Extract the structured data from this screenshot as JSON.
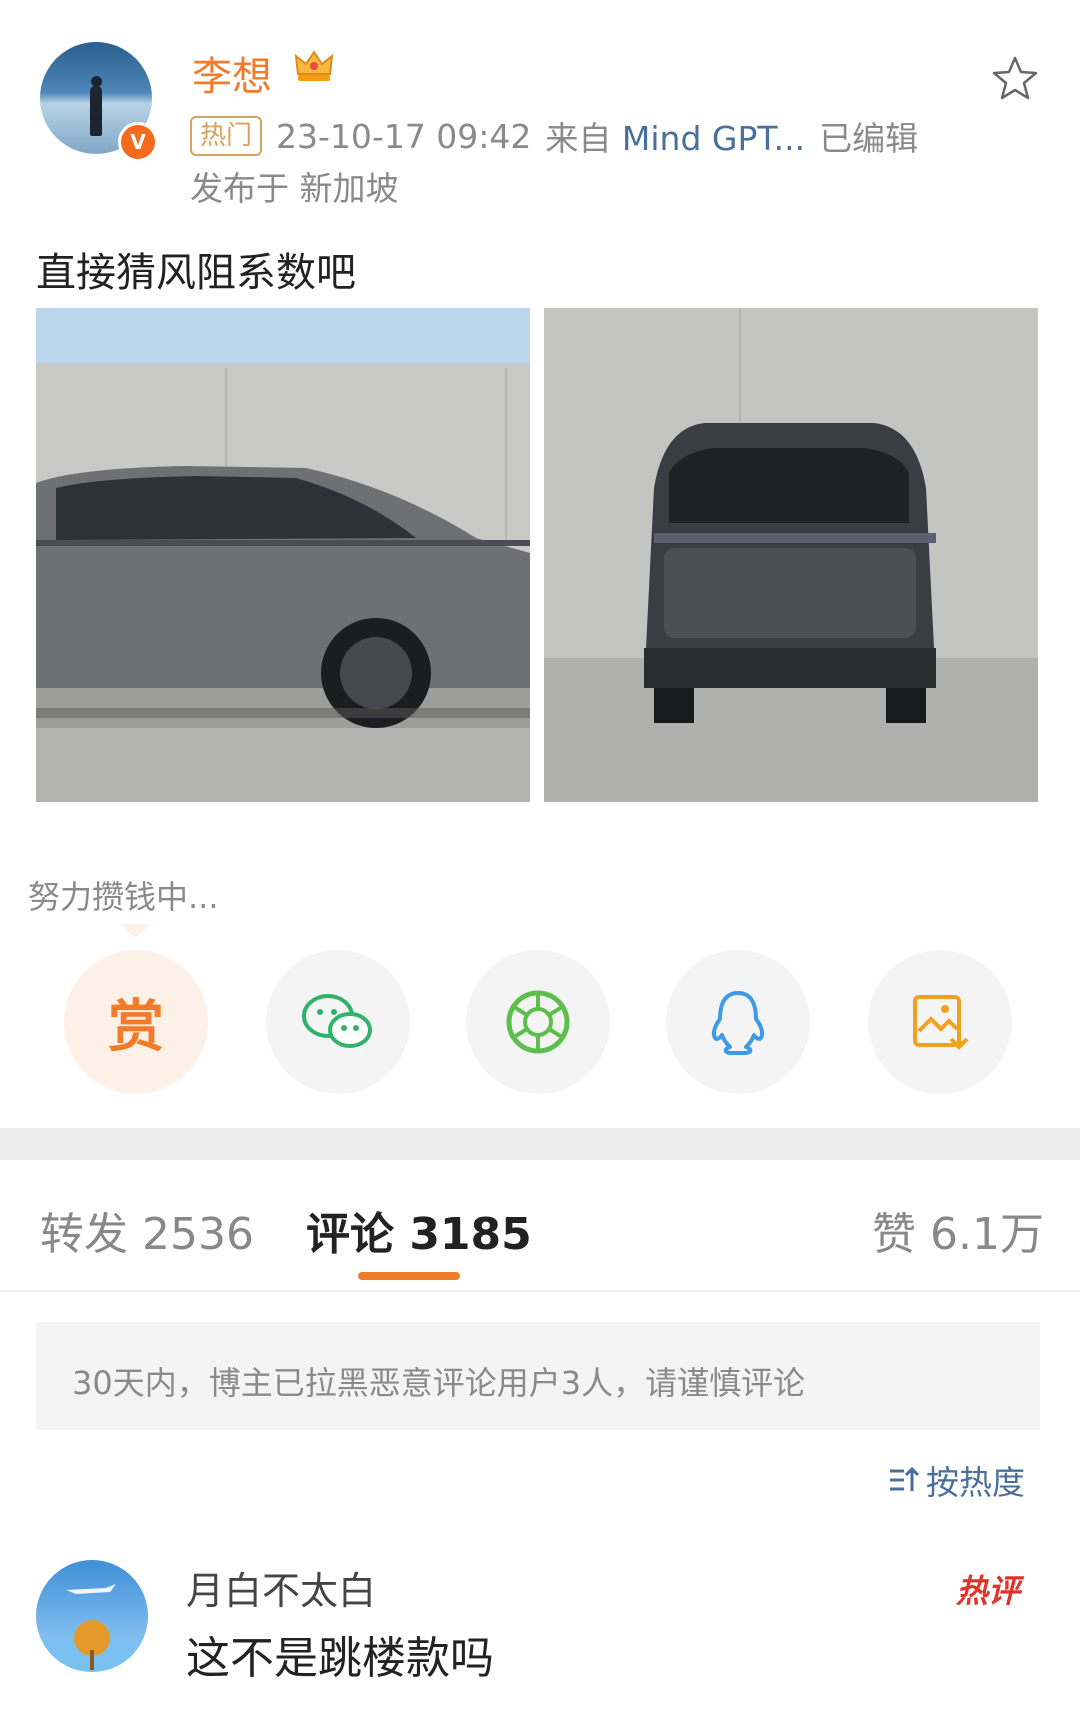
{
  "post": {
    "username": "李想",
    "hot_tag": "热门",
    "timestamp": "23-10-17 09:42",
    "source_prefix": "来自",
    "source": "Mind GPT...",
    "edited": "已编辑",
    "location": "发布于 新加坡",
    "text": "直接猜风阻系数吧",
    "verified_badge": "V"
  },
  "reward_prompt": "努力攒钱中...",
  "share": {
    "reward_label": "赏",
    "icons": [
      "reward-icon",
      "wechat-icon",
      "moments-icon",
      "qq-icon",
      "save-image-icon"
    ]
  },
  "tabs": {
    "repost": "转发 2536",
    "comments": "评论 3185",
    "likes": "赞 6.1万"
  },
  "notice": "30天内，博主已拉黑恶意评论用户3人，请谨慎评论",
  "sort_label": "按热度",
  "comment": {
    "username": "月白不太白",
    "text": "这不是跳楼款吗",
    "badge": "热评"
  },
  "colors": {
    "accent": "#f07b2a",
    "link": "#4a6f9b",
    "hot": "#e0342a"
  }
}
